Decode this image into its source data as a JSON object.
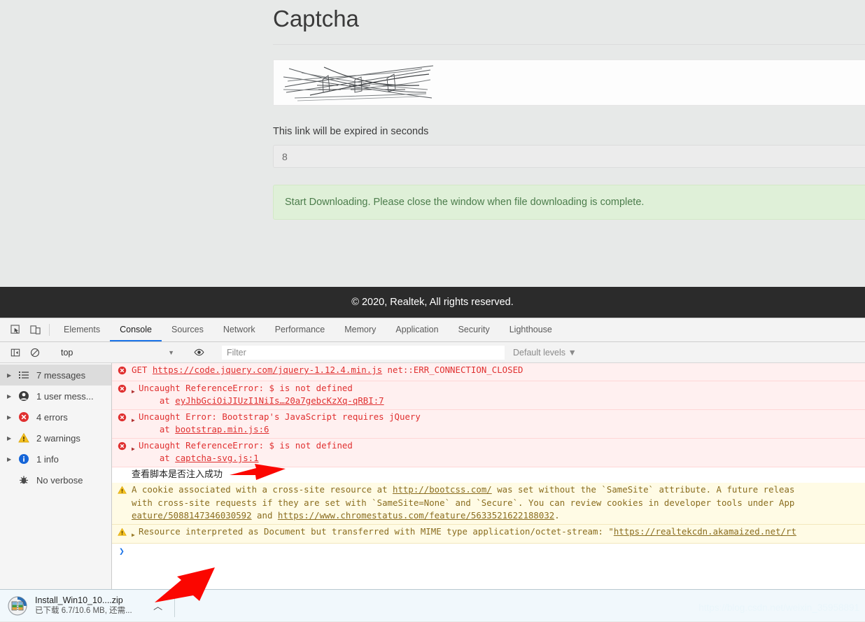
{
  "page": {
    "title": "Captcha",
    "expire_text": "This link will be expired in  seconds",
    "seconds_value": "8",
    "seconds_placeholder": "8",
    "alert_text": "Start Downloading. Please close the window when file downloading is complete.",
    "footer": "© 2020, Realtek, All rights reserved."
  },
  "devtools": {
    "tabs": [
      {
        "label": "Elements",
        "active": false
      },
      {
        "label": "Console",
        "active": true
      },
      {
        "label": "Sources",
        "active": false
      },
      {
        "label": "Network",
        "active": false
      },
      {
        "label": "Performance",
        "active": false
      },
      {
        "label": "Memory",
        "active": false
      },
      {
        "label": "Application",
        "active": false
      },
      {
        "label": "Security",
        "active": false
      },
      {
        "label": "Lighthouse",
        "active": false
      }
    ],
    "toolbar": {
      "context": "top",
      "filter_placeholder": "Filter",
      "filter_value": "",
      "levels": "Default levels ▼"
    },
    "sidebar": [
      {
        "label": "7 messages",
        "icon": "list-icon",
        "selected": true
      },
      {
        "label": "1 user mess...",
        "icon": "user-icon",
        "selected": false
      },
      {
        "label": "4 errors",
        "icon": "error-icon",
        "selected": false
      },
      {
        "label": "2 warnings",
        "icon": "warning-icon",
        "selected": false
      },
      {
        "label": "1 info",
        "icon": "info-icon",
        "selected": false
      },
      {
        "label": "No verbose",
        "icon": "bug-icon",
        "selected": false
      }
    ],
    "messages": {
      "m1_pre": "GET ",
      "m1_link": "https://code.jquery.com/jquery-1.12.4.min.js",
      "m1_post": " net::ERR_CONNECTION_CLOSED",
      "m2_main": "Uncaught ReferenceError: $ is not defined",
      "m2_at": "    at ",
      "m2_link": "eyJhbGciOiJIUzI1NiIs…20a7gebcKzXq-qRBI:7",
      "m3_main": "Uncaught Error: Bootstrap's JavaScript requires jQuery",
      "m3_at": "    at ",
      "m3_link": "bootstrap.min.js:6",
      "m4_main": "Uncaught ReferenceError: $ is not defined",
      "m4_at": "    at ",
      "m4_link": "captcha-svg.js:1",
      "m5_note": "查看脚本是否注入成功",
      "m6_a": "A cookie associated with a cross-site resource at ",
      "m6_link1": "http://bootcss.com/",
      "m6_b": " was set without the `SameSite` attribute. A future releas",
      "m6_c": "with cross-site requests if they are set with `SameSite=None` and `Secure`. You can review cookies in developer tools under App",
      "m6_link2": "eature/5088147346030592",
      "m6_d": " and ",
      "m6_link3": "https://www.chromestatus.com/feature/5633521622188032",
      "m6_e": ".",
      "m7_main": "Resource interpreted as Document but transferred with MIME type application/octet-stream: \"",
      "m7_link": "https://realtekcdn.akamaized.net/rt",
      "prompt": "❯"
    }
  },
  "download_shelf": {
    "file_name": "Install_Win10_10....zip",
    "status": "已下载 6.7/10.6 MB, 还需...",
    "caret": "︿"
  },
  "watermark": "https://blog.csdn.net/weixin_35958891"
}
